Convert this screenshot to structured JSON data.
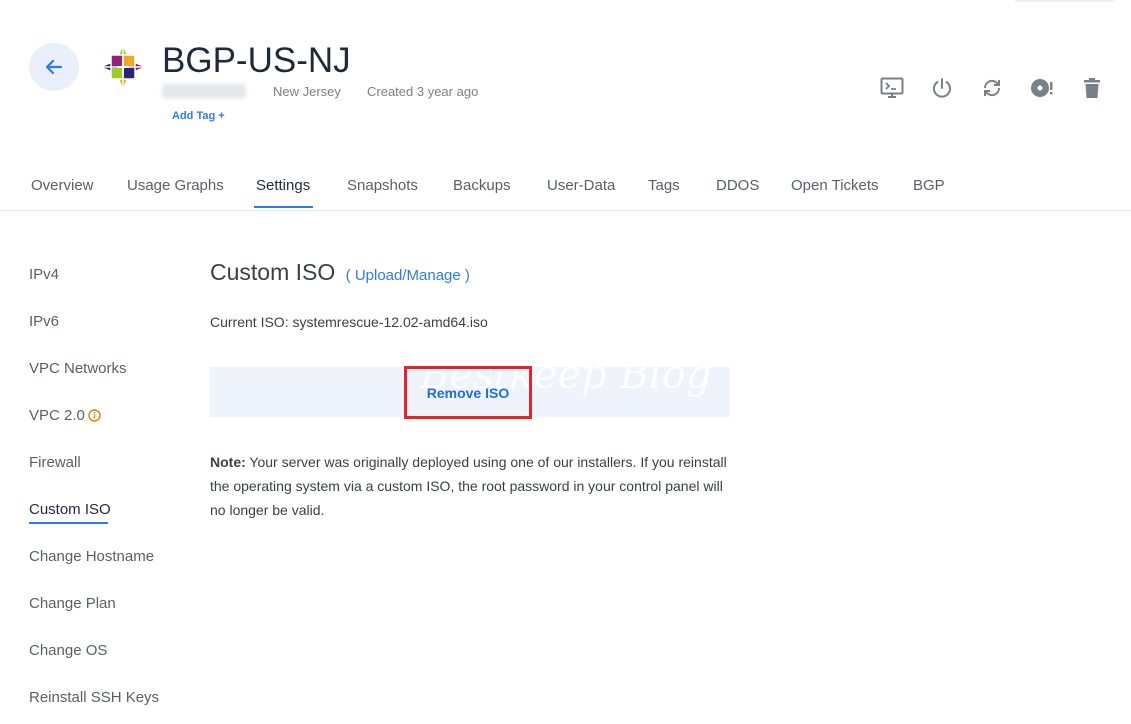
{
  "server": {
    "title": "BGP-US-NJ",
    "location": "New Jersey",
    "created": "Created 3 year ago",
    "add_tag": "Add Tag +"
  },
  "actions": [
    {
      "name": "console-icon"
    },
    {
      "name": "power-icon"
    },
    {
      "name": "restart-icon"
    },
    {
      "name": "iso-disc-icon"
    },
    {
      "name": "trash-icon"
    }
  ],
  "tabs": [
    "Overview",
    "Usage Graphs",
    "Settings",
    "Snapshots",
    "Backups",
    "User-Data",
    "Tags",
    "DDOS",
    "Open Tickets",
    "BGP"
  ],
  "active_tab": "Settings",
  "sidebar": [
    "IPv4",
    "IPv6",
    "VPC Networks",
    "VPC 2.0",
    "Firewall",
    "Custom ISO",
    "Change Hostname",
    "Change Plan",
    "Change OS",
    "Reinstall SSH Keys"
  ],
  "active_sidebar": "Custom ISO",
  "main": {
    "title": "Custom ISO",
    "link": "( Upload/Manage )",
    "current_iso": "Current ISO: systemrescue-12.02-amd64.iso",
    "remove_button": "Remove ISO",
    "watermark": "Bestkeep Blog",
    "note_label": "Note:",
    "note_text": " Your server was originally deployed using one of our installers. If you reinstall the operating system via a custom ISO, the root password in your control panel will no longer be valid."
  },
  "colors": {
    "accent": "#2d7be5",
    "highlight_border": "#e4242b",
    "button_bg": "#eef3fc"
  }
}
